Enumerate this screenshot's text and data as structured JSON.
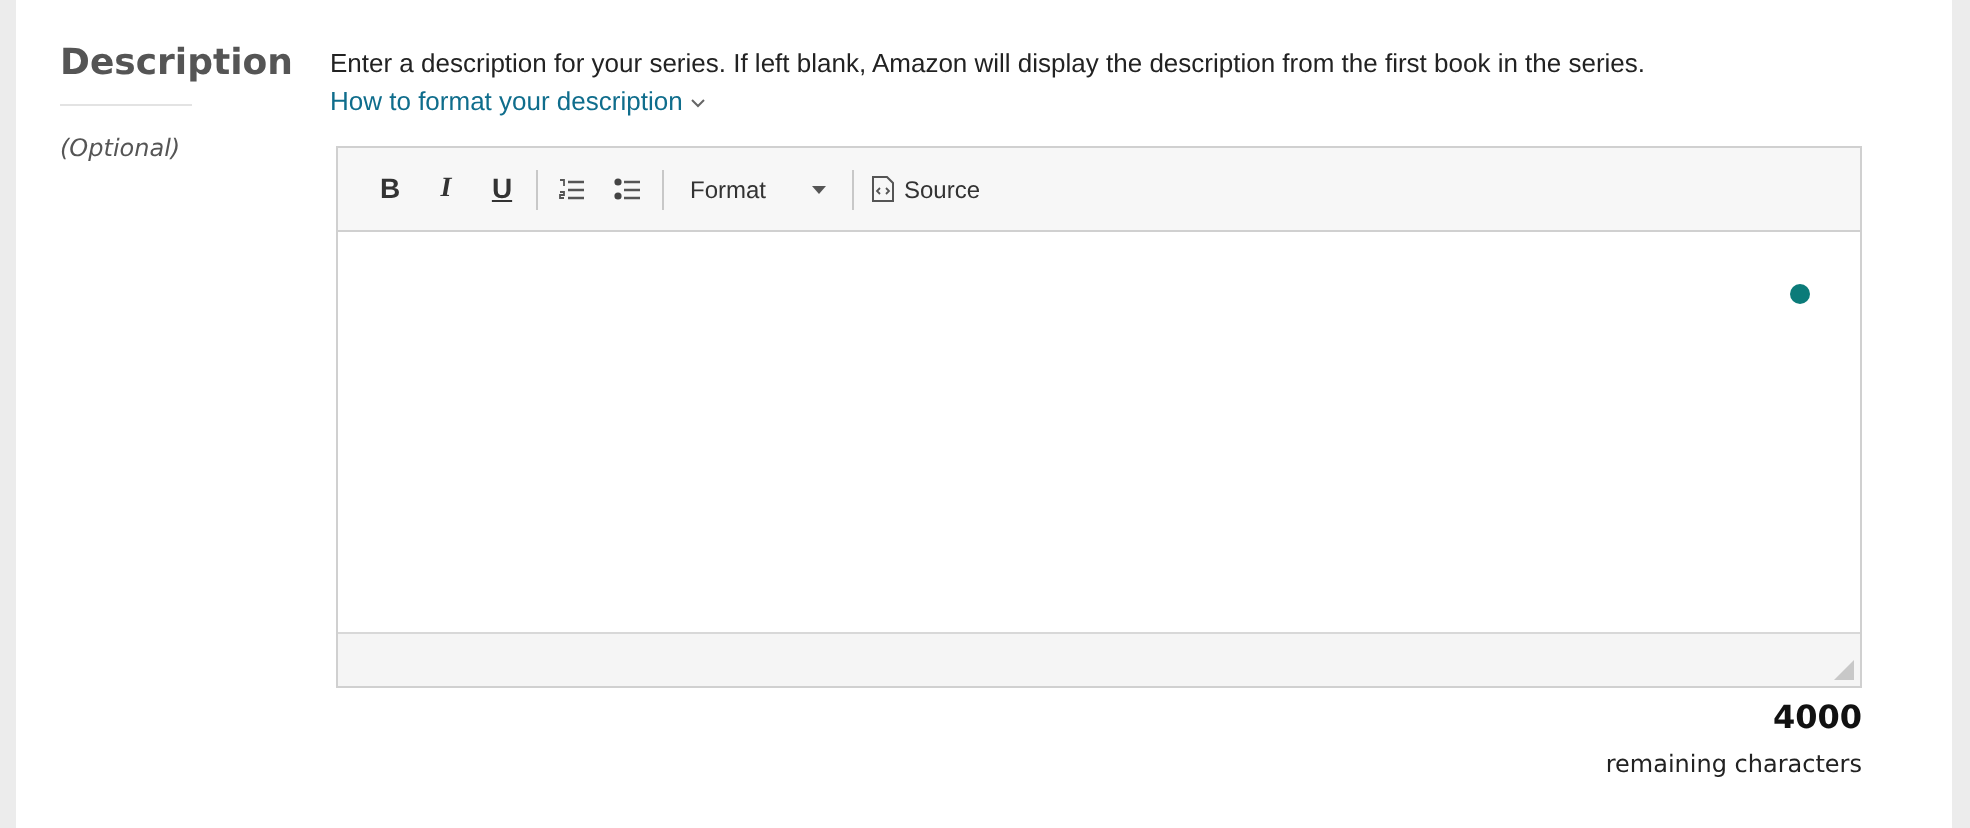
{
  "section": {
    "title": "Description",
    "note": "(Optional)"
  },
  "help": {
    "text": "Enter a description for your series. If left blank, Amazon will display the description from the first book in the series.",
    "link": "How to format your description"
  },
  "editor": {
    "toolbar": [
      {
        "kind": "bold",
        "label": "B"
      },
      {
        "kind": "italic",
        "label": "I"
      },
      {
        "kind": "underline",
        "label": "U"
      },
      {
        "kind": "sep"
      },
      {
        "kind": "numbered"
      },
      {
        "kind": "bulleted"
      },
      {
        "kind": "sep"
      },
      {
        "kind": "dropdown",
        "label": "Format"
      },
      {
        "kind": "sep"
      },
      {
        "kind": "source",
        "label": "Source"
      }
    ]
  },
  "counter": {
    "value": "4000",
    "label": "remaining characters"
  }
}
